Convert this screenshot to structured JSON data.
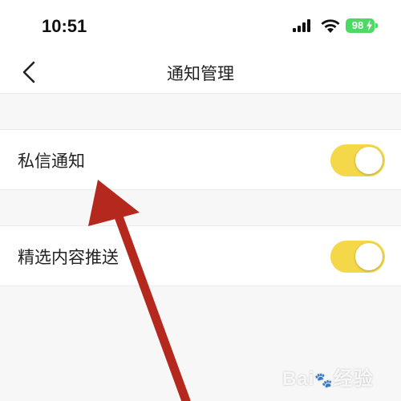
{
  "status_bar": {
    "time": "10:51",
    "battery": "98",
    "battery_color": "#4cd964"
  },
  "nav": {
    "title": "通知管理",
    "back_icon": "chevron-left-icon"
  },
  "settings": [
    {
      "label": "私信通知",
      "enabled": true
    },
    {
      "label": "精选内容推送",
      "enabled": true
    }
  ],
  "colors": {
    "toggle_on": "#f5d84a",
    "arrow": "#b5281e"
  },
  "watermark": {
    "text": "Bai",
    "suffix": "经验"
  }
}
